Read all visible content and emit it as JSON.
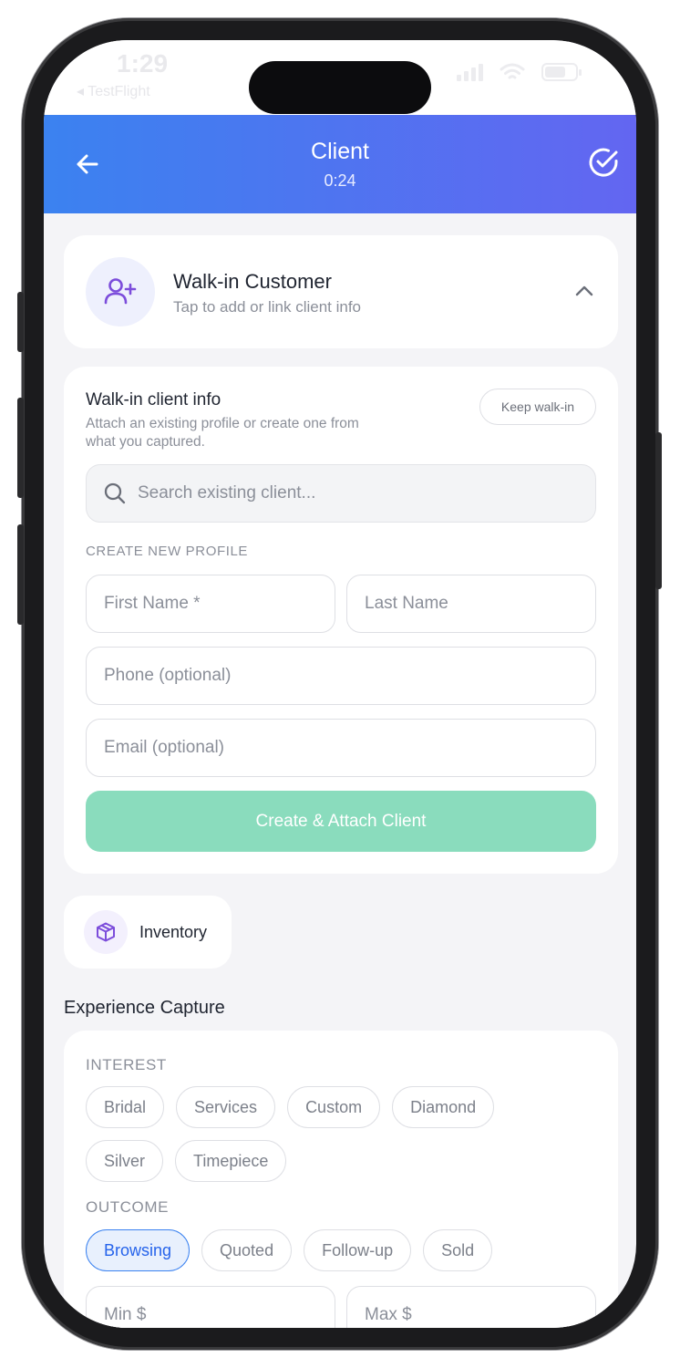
{
  "status_bar": {
    "time": "1:29",
    "back_app": "◂ TestFlight"
  },
  "header": {
    "title": "Client",
    "timer": "0:24"
  },
  "walkin": {
    "title": "Walk-in Customer",
    "subtitle": "Tap to add or link client info"
  },
  "client_info": {
    "title": "Walk-in client info",
    "description": "Attach an existing profile or create one from what you captured.",
    "keep_button": "Keep walk-in",
    "search_placeholder": "Search existing client...",
    "create_section_label": "CREATE NEW PROFILE",
    "first_name_placeholder": "First Name *",
    "last_name_placeholder": "Last Name",
    "phone_placeholder": "Phone (optional)",
    "email_placeholder": "Email (optional)",
    "create_button": "Create & Attach Client"
  },
  "inventory": {
    "label": "Inventory"
  },
  "experience": {
    "title": "Experience Capture",
    "interest_label": "INTEREST",
    "interest_options": [
      "Bridal",
      "Services",
      "Custom",
      "Diamond",
      "Silver",
      "Timepiece"
    ],
    "outcome_label": "OUTCOME",
    "outcome_options": [
      "Browsing",
      "Quoted",
      "Follow-up",
      "Sold"
    ],
    "outcome_selected": "Browsing",
    "min_placeholder": "Min $",
    "max_placeholder": "Max $"
  },
  "colors": {
    "header_gradient_start": "#3b82f0",
    "header_gradient_end": "#6366f1",
    "accent_purple": "#7c4ddb",
    "create_button": "#8adcbd",
    "selected_chip": "#3b82f0"
  }
}
